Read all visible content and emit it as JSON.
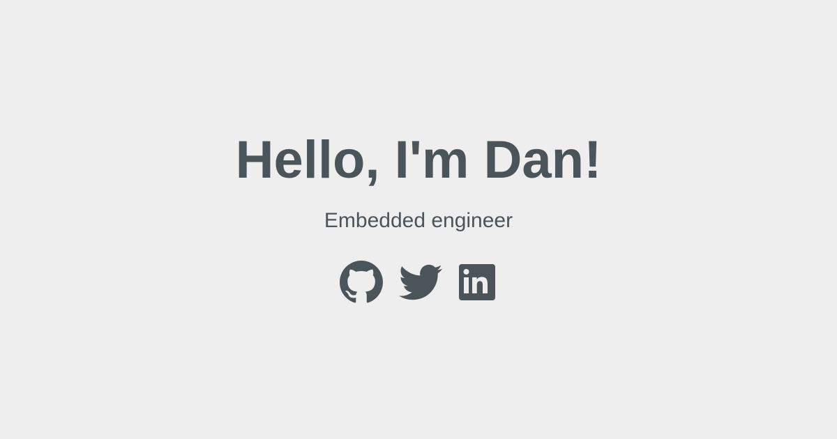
{
  "hero": {
    "title": "Hello, I'm Dan!",
    "subtitle": "Embedded engineer"
  },
  "social_links": [
    {
      "name": "GitHub",
      "icon": "github-icon"
    },
    {
      "name": "Twitter",
      "icon": "twitter-icon"
    },
    {
      "name": "LinkedIn",
      "icon": "linkedin-icon"
    }
  ],
  "colors": {
    "background": "#eeeeee",
    "text": "#4a5459"
  }
}
